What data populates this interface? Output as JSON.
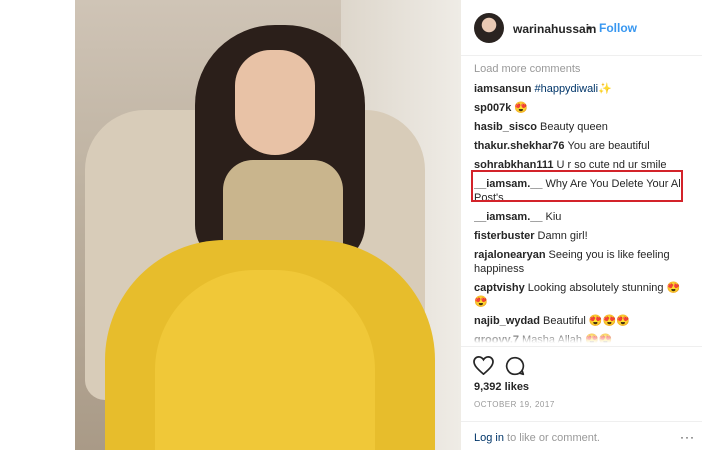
{
  "header": {
    "username": "warinahussain",
    "separator": "•",
    "follow_label": "Follow"
  },
  "comments_section": {
    "load_more_label": "Load more comments",
    "items": [
      {
        "user": "iamsansun",
        "text": "#happydiwali✨",
        "is_hashtag": true
      },
      {
        "user": "sp007k",
        "text": "😍"
      },
      {
        "user": "hasib_sisco",
        "text": "Beauty queen"
      },
      {
        "user": "thakur.shekhar76",
        "text": "You are beautiful"
      },
      {
        "user": "sohrabkhan111",
        "text": "U r so cute nd ur smile"
      },
      {
        "user": "__iamsam.__",
        "text": "Why Are You Delete Your All Post's"
      },
      {
        "user": "__iamsam.__",
        "text": "Kiu"
      },
      {
        "user": "fisterbuster",
        "text": "Damn girl!"
      },
      {
        "user": "rajalonearyan",
        "text": "Seeing you is like feeling happiness"
      },
      {
        "user": "captvishy",
        "text": "Looking absolutely stunning 😍😍"
      },
      {
        "user": "najib_wydad",
        "text": "Beautiful 😍😍😍"
      },
      {
        "user": "groovy.7",
        "text": "Masha Allah 😍😍"
      }
    ]
  },
  "footer": {
    "likes": "9,392 likes",
    "date": "OCTOBER 19, 2017",
    "login_link": "Log in",
    "login_text": " to like or comment.",
    "more_label": "···"
  },
  "colors": {
    "link_blue": "#3897f0",
    "highlight_red": "#d3232a"
  },
  "icons": [
    "heart-icon",
    "comment-icon",
    "more-options-icon"
  ]
}
